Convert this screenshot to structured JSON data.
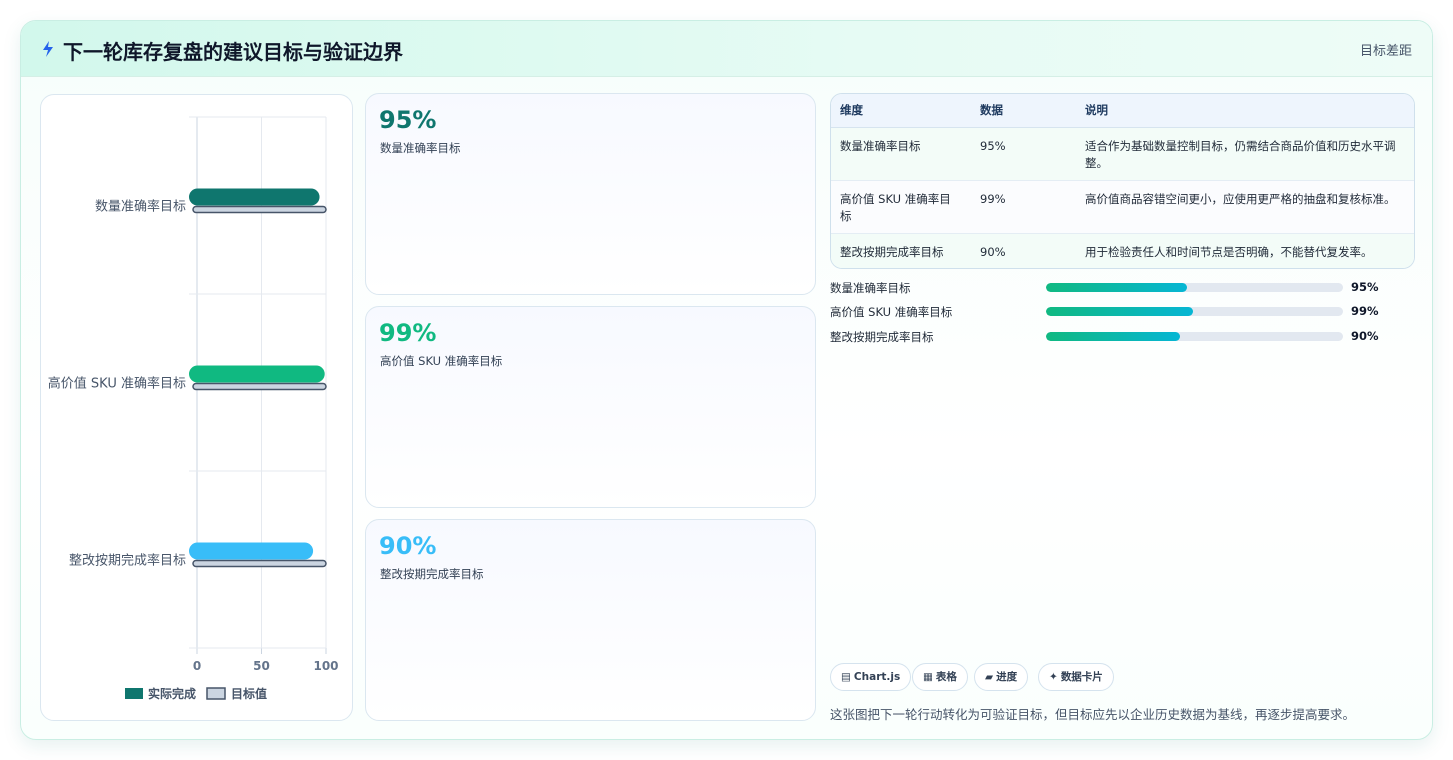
{
  "header": {
    "title": "下一轮库存复盘的建议目标与验证边界",
    "right_label": "目标差距"
  },
  "chart_data": {
    "type": "bar",
    "orientation": "horizontal",
    "categories": [
      "数量准确率目标",
      "高价值 SKU 准确率目标",
      "整改按期完成率目标"
    ],
    "series": [
      {
        "name": "实际完成",
        "values": [
          95,
          99,
          90
        ],
        "colors": [
          "#0f766e",
          "#10b981",
          "#38bdf8"
        ]
      },
      {
        "name": "目标值",
        "values": [
          100,
          100,
          100
        ],
        "color": "#cbd5e1"
      }
    ],
    "xlim": [
      0,
      100
    ],
    "xticks": [
      "0",
      "50",
      "100"
    ],
    "grid": true,
    "legend": "bottom"
  },
  "kpis": [
    {
      "value": "95%",
      "label": "数量准确率目标",
      "color": "#0f766e"
    },
    {
      "value": "99%",
      "label": "高价值 SKU 准确率目标",
      "color": "#10b981"
    },
    {
      "value": "90%",
      "label": "整改按期完成率目标",
      "color": "#38bdf8"
    }
  ],
  "table": {
    "headers": [
      "维度",
      "数据",
      "说明"
    ],
    "rows": [
      [
        "数量准确率目标",
        "95%",
        "适合作为基础数量控制目标，仍需结合商品价值和历史水平调整。"
      ],
      [
        "高价值 SKU 准确率目标",
        "99%",
        "高价值商品容错空间更小，应使用更严格的抽盘和复核标准。"
      ],
      [
        "整改按期完成率目标",
        "90%",
        "用于检验责任人和时间节点是否明确，不能替代复发率。"
      ]
    ]
  },
  "progress": [
    {
      "label": "数量准确率目标",
      "value": 95,
      "display": "95%"
    },
    {
      "label": "高价值 SKU 准确率目标",
      "value": 99,
      "display": "99%"
    },
    {
      "label": "整改按期完成率目标",
      "value": 90,
      "display": "90%"
    }
  ],
  "tags": [
    {
      "icon": "▤",
      "icon_name": "chart-icon",
      "label": "Chart.js"
    },
    {
      "icon": "▦",
      "icon_name": "table-icon",
      "label": "表格"
    },
    {
      "icon": "▰",
      "icon_name": "progress-icon",
      "label": "进度"
    },
    {
      "icon": "✦",
      "icon_name": "sparkle-icon",
      "label": "数据卡片"
    }
  ],
  "footnote": "这张图把下一轮行动转化为可验证目标，但目标应先以企业历史数据为基线，再逐步提高要求。"
}
